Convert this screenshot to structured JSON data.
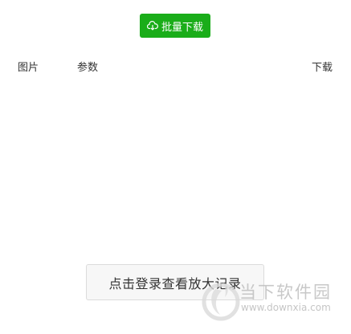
{
  "toolbar": {
    "batch_download_label": "批量下载",
    "batch_download_icon": "cloud-download-icon",
    "accent_color": "#1aad19"
  },
  "table": {
    "headers": [
      "图片",
      "参数",
      "下载"
    ]
  },
  "login_button": {
    "label": "点击登录查看放大记录"
  },
  "watermark": {
    "title": "当下软件园",
    "url": "www.downxia.com"
  }
}
